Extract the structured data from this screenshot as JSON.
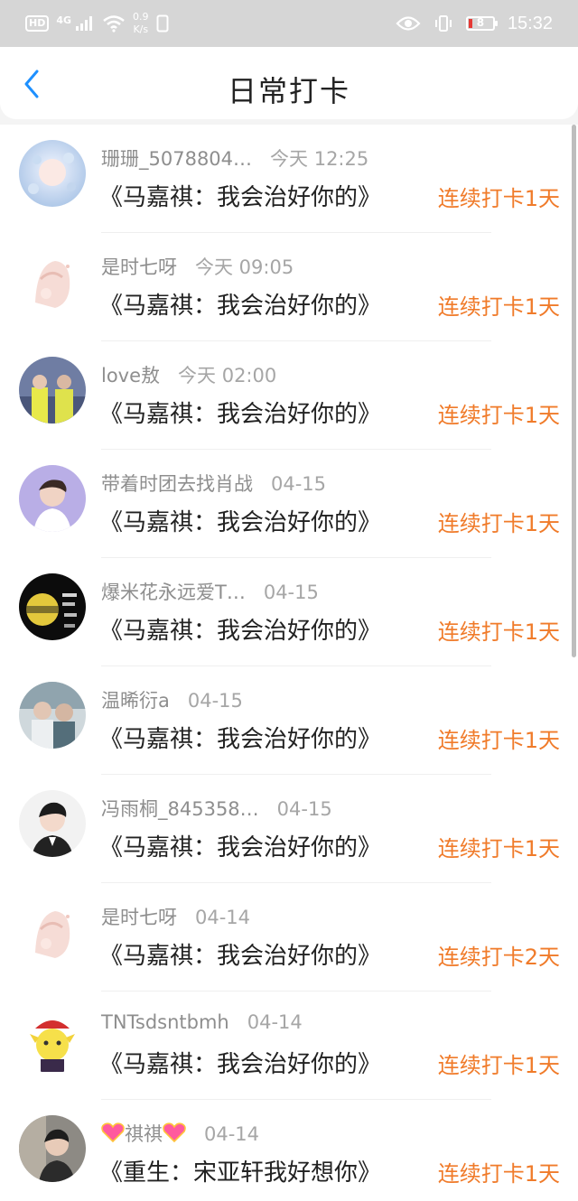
{
  "status_bar": {
    "hd": "HD",
    "network": "4G",
    "speed_value": "0.9",
    "speed_unit": "K/s",
    "battery_level": "8",
    "time": "15:32"
  },
  "nav": {
    "title": "日常打卡"
  },
  "colors": {
    "accent": "#f07b2a",
    "back_icon": "#1e90ff"
  },
  "items": [
    {
      "name": "珊珊_5078804…",
      "time": "今天 12:25",
      "book": "《马嘉祺：我会治好你的》",
      "streak": "连续打卡1天"
    },
    {
      "name": "是时七呀",
      "time": "今天 09:05",
      "book": "《马嘉祺：我会治好你的》",
      "streak": "连续打卡1天"
    },
    {
      "name": "love敖",
      "time": "今天 02:00",
      "book": "《马嘉祺：我会治好你的》",
      "streak": "连续打卡1天"
    },
    {
      "name": "带着时团去找肖战",
      "time": "04-15",
      "book": "《马嘉祺：我会治好你的》",
      "streak": "连续打卡1天"
    },
    {
      "name": "爆米花永远爱T…",
      "time": "04-15",
      "book": "《马嘉祺：我会治好你的》",
      "streak": "连续打卡1天"
    },
    {
      "name": "温晞衍a",
      "time": "04-15",
      "book": "《马嘉祺：我会治好你的》",
      "streak": "连续打卡1天"
    },
    {
      "name": "冯雨桐_845358…",
      "time": "04-15",
      "book": "《马嘉祺：我会治好你的》",
      "streak": "连续打卡1天"
    },
    {
      "name": "是时七呀",
      "time": "04-14",
      "book": "《马嘉祺：我会治好你的》",
      "streak": "连续打卡2天"
    },
    {
      "name": "TNTsdsntbmh",
      "time": "04-14",
      "book": "《马嘉祺：我会治好你的》",
      "streak": "连续打卡1天"
    },
    {
      "name": "祺祺",
      "time": "04-14",
      "book": "《重生：宋亚轩我好想你》",
      "streak": "连续打卡1天"
    }
  ]
}
